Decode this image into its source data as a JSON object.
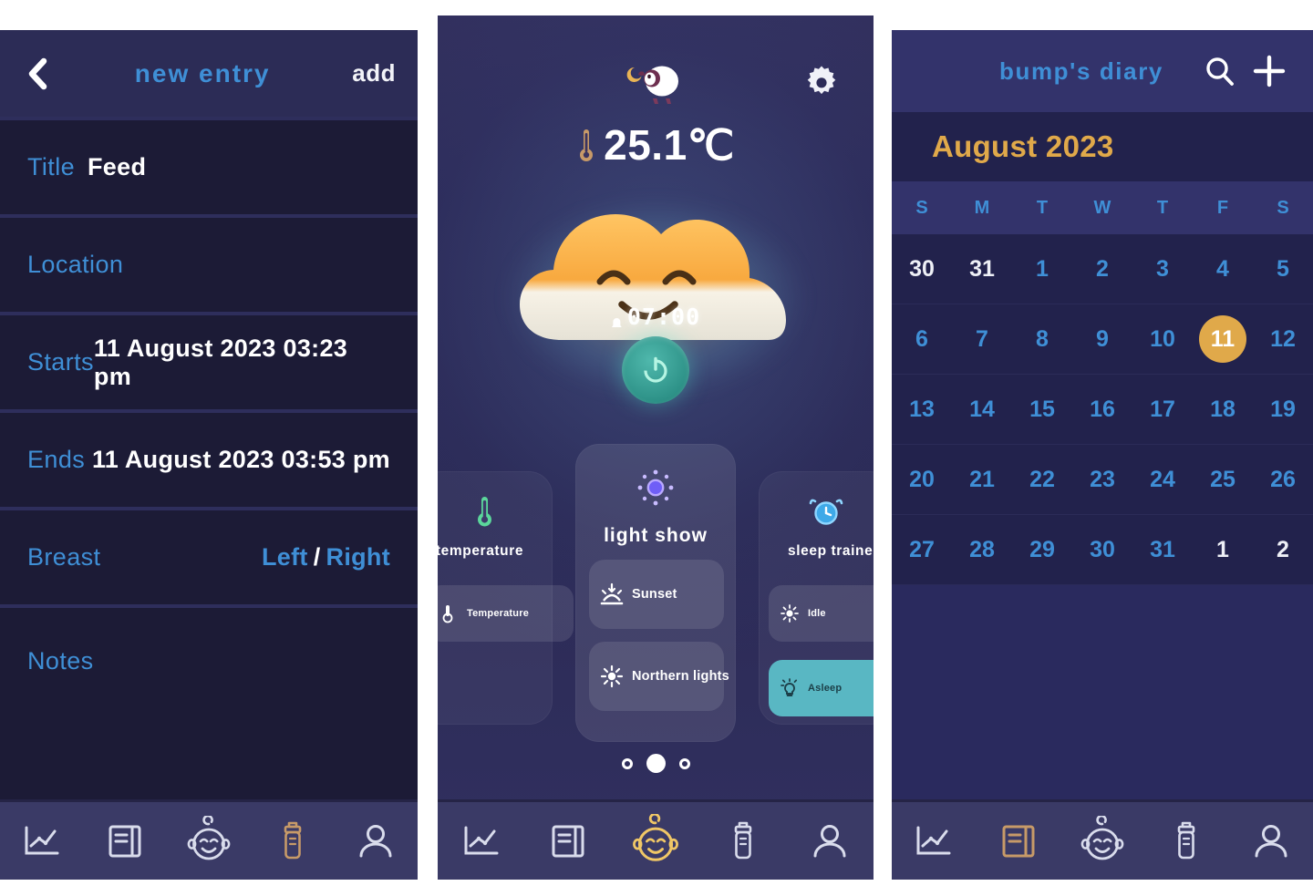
{
  "left_panel": {
    "header": {
      "back_icon": "chevron-left-icon",
      "title": "new entry",
      "add_label": "add"
    },
    "fields": [
      {
        "label": "Title",
        "value": "Feed",
        "type": "text-inline"
      },
      {
        "label": "Location",
        "value": "",
        "type": "text-inline"
      },
      {
        "label": "Starts",
        "value": "11 August 2023 03:23 pm",
        "type": "datetime"
      },
      {
        "label": "Ends",
        "value": "11 August 2023 03:53 pm",
        "type": "datetime"
      },
      {
        "label": "Breast",
        "option_left": "Left",
        "separator": "/",
        "option_right": "Right",
        "type": "choice"
      },
      {
        "label": "Notes",
        "value": "",
        "type": "text-inline"
      }
    ],
    "nav": [
      {
        "icon": "chart-icon",
        "name": "stats"
      },
      {
        "icon": "journal-icon",
        "name": "diary"
      },
      {
        "icon": "baby-icon",
        "name": "baby"
      },
      {
        "icon": "bottle-icon",
        "name": "feed"
      },
      {
        "icon": "person-icon",
        "name": "profile"
      }
    ]
  },
  "middle_panel": {
    "header": {
      "logo_icon": "sheep-moon-icon",
      "settings_icon": "gear-icon"
    },
    "temperature": {
      "icon": "thermometer-icon",
      "value": "25.1℃"
    },
    "device": {
      "icon": "smiling-cloud-icon",
      "alarm_icon": "bell-icon",
      "alarm_time": "07:00",
      "power_icon": "power-icon"
    },
    "cards": [
      {
        "id": "temperature",
        "icon": "thermometer-icon",
        "title": "temperature",
        "options": [
          {
            "icon": "thermometer-icon",
            "label": "Temperature",
            "active": false
          }
        ]
      },
      {
        "id": "light-show",
        "icon": "sun-burst-icon",
        "title": "light show",
        "options": [
          {
            "icon": "sunset-icon",
            "label": "Sunset",
            "active": false
          },
          {
            "icon": "northern-lights-icon",
            "label": "Northern lights",
            "active": false
          }
        ]
      },
      {
        "id": "sleep-trainer",
        "icon": "alarm-clock-icon",
        "title": "sleep trainer",
        "options": [
          {
            "icon": "sun-icon",
            "label": "Idle",
            "active": false
          },
          {
            "icon": "bulb-icon",
            "label": "Asleep",
            "active": true
          }
        ]
      }
    ],
    "pager": {
      "count": 3,
      "active_index": 1
    },
    "nav": [
      {
        "icon": "chart-icon",
        "name": "stats",
        "active": false
      },
      {
        "icon": "journal-icon",
        "name": "diary",
        "active": false
      },
      {
        "icon": "baby-icon",
        "name": "baby",
        "active": true
      },
      {
        "icon": "bottle-icon",
        "name": "feed",
        "active": false
      },
      {
        "icon": "person-icon",
        "name": "profile",
        "active": false
      }
    ]
  },
  "right_panel": {
    "header": {
      "title": "bump's diary",
      "search_icon": "search-icon",
      "add_icon": "plus-icon"
    },
    "month": "August 2023",
    "day_headers": [
      "S",
      "M",
      "T",
      "W",
      "T",
      "F",
      "S"
    ],
    "weeks": [
      [
        {
          "d": "30",
          "out": true
        },
        {
          "d": "31",
          "out": true
        },
        {
          "d": "1"
        },
        {
          "d": "2"
        },
        {
          "d": "3"
        },
        {
          "d": "4"
        },
        {
          "d": "5"
        }
      ],
      [
        {
          "d": "6"
        },
        {
          "d": "7"
        },
        {
          "d": "8"
        },
        {
          "d": "9"
        },
        {
          "d": "10"
        },
        {
          "d": "11",
          "selected": true
        },
        {
          "d": "12"
        }
      ],
      [
        {
          "d": "13"
        },
        {
          "d": "14"
        },
        {
          "d": "15"
        },
        {
          "d": "16"
        },
        {
          "d": "17"
        },
        {
          "d": "18"
        },
        {
          "d": "19"
        }
      ],
      [
        {
          "d": "20"
        },
        {
          "d": "21"
        },
        {
          "d": "22"
        },
        {
          "d": "23"
        },
        {
          "d": "24"
        },
        {
          "d": "25"
        },
        {
          "d": "26"
        }
      ],
      [
        {
          "d": "27"
        },
        {
          "d": "28"
        },
        {
          "d": "29"
        },
        {
          "d": "30"
        },
        {
          "d": "31"
        },
        {
          "d": "1",
          "out": true
        },
        {
          "d": "2",
          "out": true
        }
      ]
    ],
    "nav": [
      {
        "icon": "chart-icon",
        "name": "stats"
      },
      {
        "icon": "journal-icon",
        "name": "diary"
      },
      {
        "icon": "baby-icon",
        "name": "baby"
      },
      {
        "icon": "bottle-icon",
        "name": "feed"
      },
      {
        "icon": "person-icon",
        "name": "profile"
      }
    ]
  },
  "colors": {
    "accent_blue": "#3f8fd6",
    "accent_gold": "#e0a94a",
    "active_teal": "#59b7c3",
    "panel_dark": "#1c1b36",
    "panel_navy": "#2a2a5e",
    "nav_bar": "#3a3a66"
  }
}
